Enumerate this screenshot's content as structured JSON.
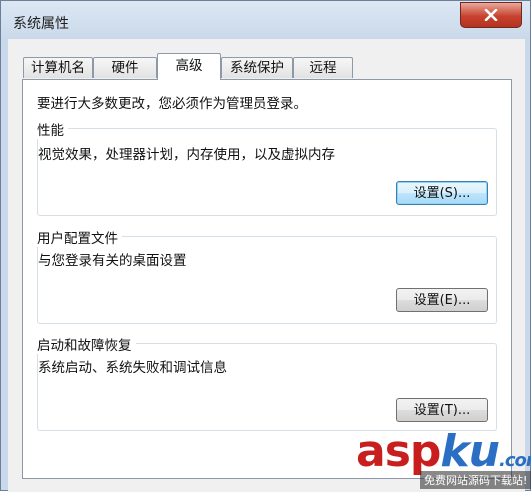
{
  "window": {
    "title": "系统属性"
  },
  "tabs": [
    {
      "label": "计算机名"
    },
    {
      "label": "硬件"
    },
    {
      "label": "高级",
      "active": true
    },
    {
      "label": "系统保护"
    },
    {
      "label": "远程"
    }
  ],
  "intro": "要进行大多数更改，您必须作为管理员登录。",
  "groups": {
    "performance": {
      "title": "性能",
      "description": "视觉效果，处理器计划，内存使用，以及虚拟内存",
      "button": "设置(S)..."
    },
    "user_profiles": {
      "title": "用户配置文件",
      "description": "与您登录有关的桌面设置",
      "button": "设置(E)..."
    },
    "startup_recovery": {
      "title": "启动和故障恢复",
      "description": "系统启动、系统失败和调试信息",
      "button": "设置(T)..."
    }
  },
  "watermark": {
    "asp": "asp",
    "ku": "ku",
    "com": ".com",
    "caption": "免费网站源码下载站!"
  },
  "colors": {
    "close_button": "#c7432f",
    "default_button_border": "#3c7fb1",
    "watermark_red": "#c81e1e",
    "watermark_blue": "#2b6fc4"
  },
  "icons": {
    "close": "close-icon"
  }
}
